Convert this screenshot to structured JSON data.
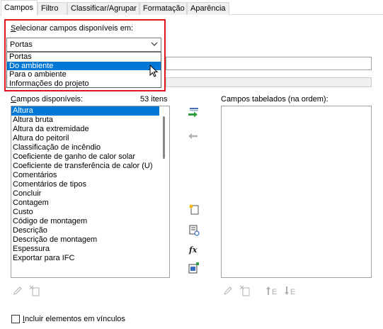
{
  "tabs": [
    {
      "label": "Campos"
    },
    {
      "label": "Filtro"
    },
    {
      "label": "Classificar/Agrupar"
    },
    {
      "label": "Formatação"
    },
    {
      "label": "Aparência"
    }
  ],
  "select_fields": {
    "label_prefix": "S",
    "label_rest": "elecionar campos disponíveis em:",
    "selected_value": "Portas",
    "options": [
      "Portas",
      "Do ambiente",
      "Para o ambiente",
      "Informações do projeto"
    ],
    "highlighted_option": "Do ambiente"
  },
  "available": {
    "label_prefix": "C",
    "label_rest": "ampos disponíveis:",
    "count": "53 itens",
    "items": [
      "Altura",
      "Altura bruta",
      "Altura da extremidade",
      "Altura do peitoril",
      "Classificação de incêndio",
      "Coeficiente de ganho de calor solar",
      "Coeficiente de transferência de calor (U)",
      "Comentários",
      "Comentários de tipos",
      "Concluir",
      "Contagem",
      "Custo",
      "Código de montagem",
      "Descrição",
      "Descrição de montagem",
      "Espessura",
      "Exportar para IFC"
    ],
    "selected_item": "Altura"
  },
  "scheduled": {
    "label": "Campos tabelados (na ordem):"
  },
  "include_links": {
    "label_prefix": "I",
    "label_rest": "ncluir elementos em vínculos",
    "checked": false
  },
  "colors": {
    "accent": "#0078d7",
    "highlight_box": "#e0141e",
    "add_arrow": "#2e9e3e"
  }
}
